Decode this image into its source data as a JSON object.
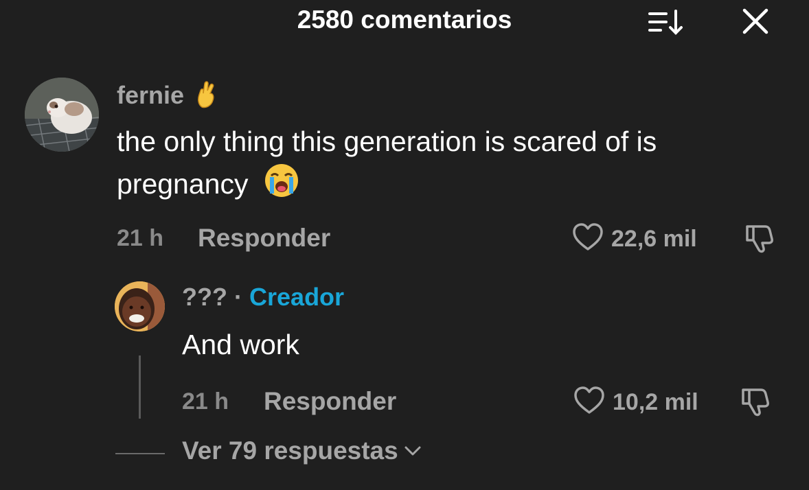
{
  "header": {
    "title": "2580 comentarios"
  },
  "comment": {
    "username": "fernie",
    "username_emoji": "crossed-fingers-icon",
    "text_line1": "the only thing this generation is scared of is",
    "text_line2": "pregnancy",
    "text_emoji": "loudly-crying-face-icon",
    "time": "21 h",
    "reply_label": "Responder",
    "likes": "22,6 mil"
  },
  "reply": {
    "username": "???",
    "separator": "·",
    "creator_label": "Creador",
    "text": "And work",
    "time": "21 h",
    "reply_label": "Responder",
    "likes": "10,2 mil"
  },
  "view_replies": {
    "label": "Ver 79 respuestas"
  },
  "colors": {
    "background": "#1f1f1f",
    "creator_accent": "#19a6d8",
    "muted_text": "#a6a6a6"
  }
}
